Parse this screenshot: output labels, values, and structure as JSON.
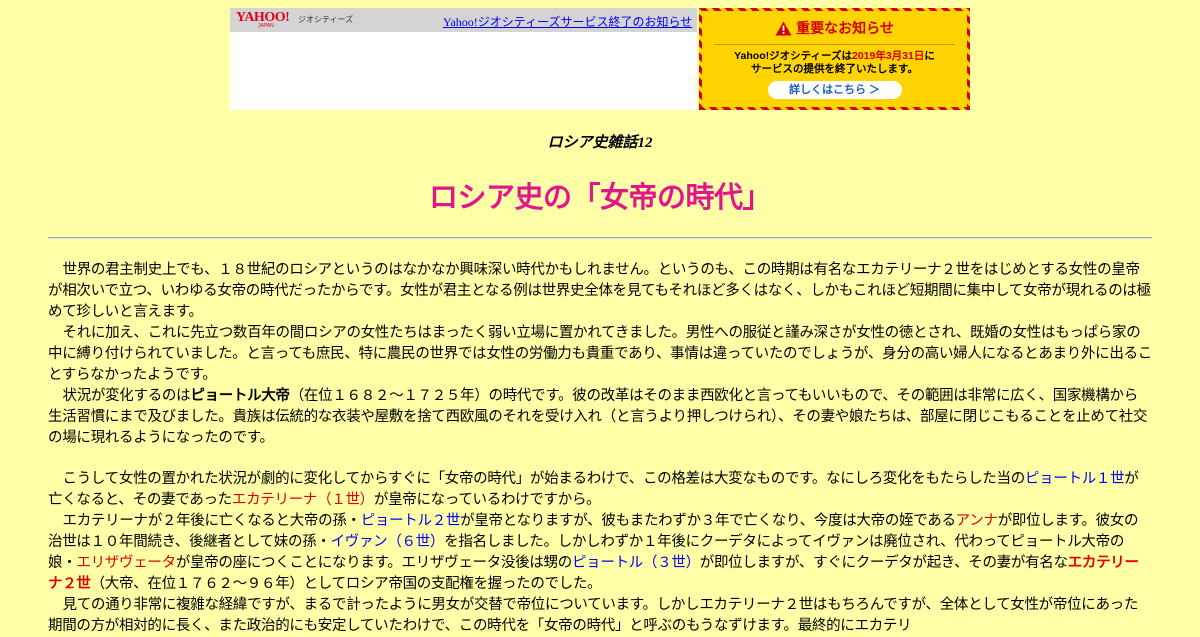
{
  "header": {
    "logo_text": "YAHOO!",
    "logo_sub": "JAPAN",
    "service_name": "ジオシティーズ",
    "notice_link": "Yahoo!ジオシティーズサービス終了のお知らせ"
  },
  "banner": {
    "title": "重要なお知らせ",
    "line1_pre": "Yahoo!ジオシティーズは",
    "line1_date": "2019年3月31日",
    "line1_post": "に",
    "line2": "サービスの提供を終了いたします。",
    "button": "詳しくはこちら ＞",
    "colors": {
      "background": "#ffd400",
      "accent": "#d40000",
      "button_text": "#1b5fb8"
    }
  },
  "page": {
    "subtitle": "ロシア史雑話12",
    "title": "ロシア史の「女帝の時代」",
    "title_color": "#e2168a"
  },
  "p1": "世界の君主制史上でも、１８世紀のロシアというのはなかなか興味深い時代かもしれません。というのも、この時期は有名なエカテリーナ２世をはじめとする女性の皇帝が相次いで立つ、いわゆる女帝の時代だったからです。女性が君主となる例は世界史全体を見てもそれほど多くはなく、しかもこれほど短期間に集中して女帝が現れるのは極めて珍しいと言えます。",
  "p2": "それに加え、これに先立つ数百年の間ロシアの女性たちはまったく弱い立場に置かれてきました。男性への服従と謹み深さが女性の徳とされ、既婚の女性はもっぱら家の中に縛り付けられていました。と言っても庶民、特に農民の世界では女性の労働力も貴重であり、事情は違っていたのでしょうが、身分の高い婦人になるとあまり外に出ることすらなかったようです。",
  "p3": {
    "a": "状況が変化するのは",
    "peter": "ピョートル大帝",
    "b": "（在位１６８２～１７２５年）の時代です。彼の改革はそのまま西欧化と言ってもいいもので、その範囲は非常に広く、国家機構から生活習慣にまで及びました。貴族は伝統的な衣装や屋敷を捨て西欧風のそれを受け入れ（と言うより押しつけられ）、その妻や娘たちは、部屋に閉じこもることを止めて社交の場に現れるようになったのです。"
  },
  "p4": {
    "a": "こうして女性の置かれた状況が劇的に変化してからすぐに「女帝の時代」が始まるわけで、この格差は大変なものです。なにしろ変化をもたらした当の",
    "peter1": "ピョートル１世",
    "b": "が亡くなると、その妻であった",
    "cath1": "エカテリーナ（１世）",
    "c": "が皇帝になっているわけですから。"
  },
  "p5": {
    "a": "エカテリーナが２年後に亡くなると大帝の孫・",
    "peter2": "ピョートル２世",
    "b": "が皇帝となりますが、彼もまたわずか３年で亡くなり、今度は大帝の姪である",
    "anna": "アンナ",
    "c": "が即位します。彼女の治世は１０年間続き、後継者として妹の孫・",
    "ivan": "イヴァン（６世）",
    "d": "を指名しました。しかしわずか１年後にクーデタによってイヴァンは廃位され、代わってピョートル大帝の娘・",
    "elizabeth": "エリザヴェータ",
    "e": "が皇帝の座につくことになります。エリザヴェータ没後は甥の",
    "peter3": "ピョートル（３世）",
    "f": "が即位しますが、すぐにクーデタが起き、その妻が有名な",
    "cath2": "エカテリーナ２世",
    "g": "（大帝、在位１７６２～９６年）としてロシア帝国の支配権を握ったのでした。"
  },
  "p6": "見ての通り非常に複雑な経緯ですが、まるで計ったように男女が交替で帝位についています。しかしエカテリーナ２世はもちろんですが、全体として女性が帝位にあった期間の方が相対的に長く、また政治的にも安定していたわけで、この時代を「女帝の時代」と呼ぶのもうなずけます。最終的にエカテリ"
}
